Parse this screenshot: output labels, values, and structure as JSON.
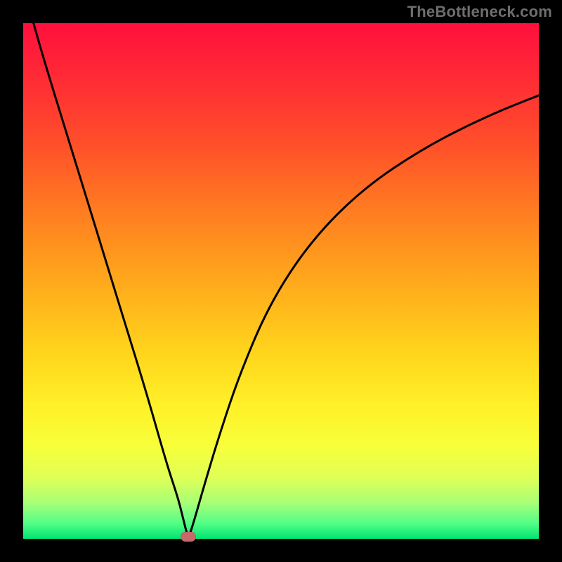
{
  "watermark": "TheBottleneck.com",
  "colors": {
    "background": "#000000",
    "gradient_top": "#ff0f3c",
    "gradient_bottom": "#00e572",
    "marker": "#c96a6a",
    "curve": "#000000"
  },
  "chart_data": {
    "type": "line",
    "title": "",
    "xlabel": "",
    "ylabel": "",
    "xlim": [
      0,
      100
    ],
    "ylim": [
      0,
      100
    ],
    "minimum_x": 32,
    "series": [
      {
        "name": "curve",
        "x": [
          2,
          4,
          8,
          12,
          16,
          20,
          24,
          28,
          30,
          31,
          32,
          33,
          35,
          38,
          42,
          48,
          56,
          66,
          78,
          90,
          100
        ],
        "y": [
          100,
          93,
          80,
          67,
          54,
          41,
          28,
          14,
          8,
          4,
          0,
          3,
          10,
          20,
          32,
          46,
          58,
          68,
          76,
          82,
          86
        ]
      }
    ],
    "marker": {
      "x": 32,
      "y": 0,
      "shape": "pill"
    },
    "grid": false,
    "legend": false,
    "background_gradient": {
      "direction": "vertical",
      "stops": [
        {
          "pos": 0.0,
          "color": "#ff0f3c"
        },
        {
          "pos": 0.5,
          "color": "#ffb51b"
        },
        {
          "pos": 0.8,
          "color": "#f7ff3a"
        },
        {
          "pos": 1.0,
          "color": "#00e572"
        }
      ]
    }
  }
}
